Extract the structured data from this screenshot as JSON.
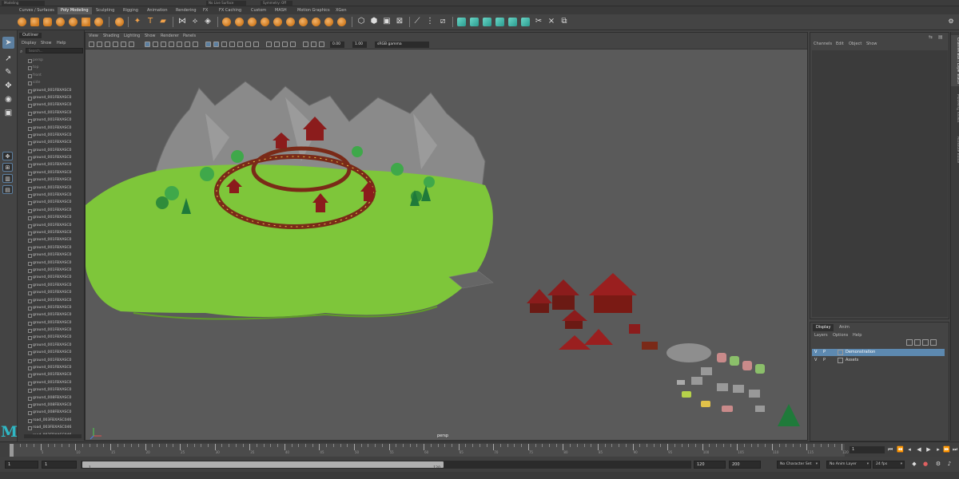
{
  "status_line": {
    "workspace": "Modeling",
    "live_surface": "No Live Surface",
    "symmetry": "Symmetry: Off"
  },
  "shelf_tabs": [
    "Curves / Surfaces",
    "Poly Modeling",
    "Sculpting",
    "Rigging",
    "Animation",
    "Rendering",
    "FX",
    "FX Caching",
    "Custom",
    "MASH",
    "Motion Graphics",
    "XGen"
  ],
  "shelf_active_tab": "Poly Modeling",
  "outliner": {
    "title": "Outliner",
    "menu": [
      "Display",
      "Show",
      "Help"
    ],
    "search_placeholder": "Search...",
    "items": [
      "persp",
      "top",
      "front",
      "side",
      "ground_001FBXASC0",
      "ground_001FBXASC0",
      "ground_001FBXASC0",
      "ground_001FBXASC0",
      "ground_001FBXASC0",
      "ground_001FBXASC0",
      "ground_001FBXASC0",
      "ground_001FBXASC0",
      "ground_001FBXASC0",
      "ground_001FBXASC0",
      "ground_001FBXASC0",
      "ground_001FBXASC0",
      "ground_001FBXASC0",
      "ground_001FBXASC0",
      "ground_001FBXASC0",
      "ground_001FBXASC0",
      "ground_001FBXASC0",
      "ground_001FBXASC0",
      "ground_001FBXASC0",
      "ground_001FBXASC0",
      "ground_001FBXASC0",
      "ground_001FBXASC0",
      "ground_001FBXASC0",
      "ground_001FBXASC0",
      "ground_001FBXASC0",
      "ground_001FBXASC0",
      "ground_001FBXASC0",
      "ground_001FBXASC0",
      "ground_001FBXASC0",
      "ground_001FBXASC0",
      "ground_001FBXASC0",
      "ground_001FBXASC0",
      "ground_001FBXASC0",
      "ground_001FBXASC0",
      "ground_001FBXASC0",
      "ground_001FBXASC0",
      "ground_001FBXASC0",
      "ground_001FBXASC0",
      "ground_001FBXASC0",
      "ground_001FBXASC0",
      "ground_001FBXASC0",
      "ground_008FBXASC0",
      "ground_008FBXASC0",
      "ground_008FBXASC0",
      "road_003FBXASC046",
      "road_003FBXASC046",
      "road_003FBXASC046",
      "road_003FBXASC046",
      "road_003FBXASC046",
      "road_003FBXASC046",
      "road_003FBXASC046"
    ]
  },
  "viewport": {
    "menu": [
      "View",
      "Shading",
      "Lighting",
      "Show",
      "Renderer",
      "Panels"
    ],
    "exposure": "0.00",
    "gamma": "1.00",
    "color_space": "sRGB gamma",
    "camera_label": "persp",
    "ground_color": "#7ec63a",
    "rock_color": "#8c8c8c"
  },
  "channel_box": {
    "menu": [
      "Channels",
      "Edit",
      "Object",
      "Show"
    ]
  },
  "layer_editor": {
    "tabs": [
      "Display",
      "Anim"
    ],
    "active_tab": "Display",
    "menu": [
      "Layers",
      "Options",
      "Help"
    ],
    "layers": [
      {
        "v": "V",
        "p": "P",
        "name": "Demonstration",
        "selected": true
      },
      {
        "v": "V",
        "p": "P",
        "name": "Assets",
        "selected": false
      }
    ],
    "selection_color": "#5d89b0"
  },
  "side_tabs": [
    "Channel Box / Layer Editor",
    "Modeling Toolkit",
    "Attribute Editor"
  ],
  "timeline": {
    "tick_labels": [
      "5",
      "10",
      "15",
      "20",
      "25",
      "30",
      "35",
      "40",
      "45",
      "50",
      "55",
      "60",
      "65",
      "70",
      "75",
      "80",
      "85",
      "90",
      "95",
      "100",
      "105",
      "110",
      "115",
      "120"
    ],
    "current_frame": "1"
  },
  "range": {
    "start_field": "1",
    "playback_start": "1",
    "range_start": "1",
    "range_end": "120",
    "playback_end": "120",
    "end_field": "200",
    "character_set": "No Character Set",
    "anim_layer": "No Anim Layer",
    "fps": "24 fps"
  }
}
